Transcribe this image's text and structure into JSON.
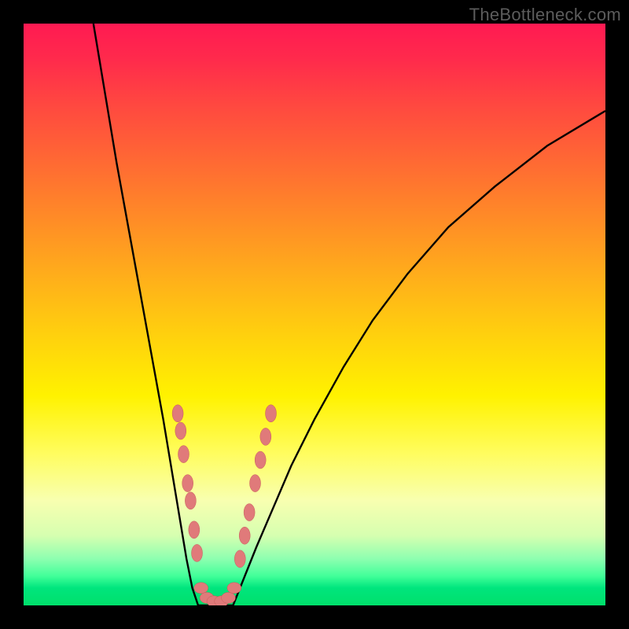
{
  "watermark": "TheBottleneck.com",
  "colors": {
    "frame": "#000000",
    "curve": "#000000",
    "marker_fill": "#e07a7a",
    "marker_stroke": "#c95a5a",
    "gradient_top": "#ff1a52",
    "gradient_mid": "#fff200",
    "gradient_bottom": "#00e06b"
  },
  "chart_data": {
    "type": "line",
    "title": "",
    "xlabel": "",
    "ylabel": "",
    "xlim": [
      0,
      100
    ],
    "ylim": [
      0,
      100
    ],
    "grid": false,
    "legend": false,
    "annotations": [],
    "series": [
      {
        "name": "left-curve",
        "x": [
          12,
          14,
          16,
          18,
          20,
          22,
          24,
          25,
          26,
          27,
          28,
          29,
          30
        ],
        "y": [
          100,
          88,
          76,
          65,
          54,
          43,
          32,
          26,
          20,
          14,
          8,
          3,
          0
        ]
      },
      {
        "name": "right-curve",
        "x": [
          36,
          38,
          40,
          43,
          46,
          50,
          55,
          60,
          66,
          73,
          81,
          90,
          100
        ],
        "y": [
          0,
          5,
          10,
          17,
          24,
          32,
          41,
          49,
          57,
          65,
          72,
          79,
          85
        ]
      },
      {
        "name": "valley-floor",
        "x": [
          30,
          31,
          32,
          33,
          34,
          35,
          36
        ],
        "y": [
          0,
          0,
          0,
          0,
          0,
          0,
          0
        ]
      }
    ],
    "markers": {
      "left_cluster": [
        {
          "x": 26.5,
          "y": 33
        },
        {
          "x": 27.0,
          "y": 30
        },
        {
          "x": 27.5,
          "y": 26
        },
        {
          "x": 28.2,
          "y": 21
        },
        {
          "x": 28.7,
          "y": 18
        },
        {
          "x": 29.3,
          "y": 13
        },
        {
          "x": 29.8,
          "y": 9
        }
      ],
      "floor_cluster": [
        {
          "x": 30.5,
          "y": 3
        },
        {
          "x": 31.5,
          "y": 1.3
        },
        {
          "x": 32.7,
          "y": 0.7
        },
        {
          "x": 34.0,
          "y": 0.7
        },
        {
          "x": 35.2,
          "y": 1.3
        },
        {
          "x": 36.2,
          "y": 3
        }
      ],
      "right_cluster": [
        {
          "x": 37.2,
          "y": 8
        },
        {
          "x": 38.0,
          "y": 12
        },
        {
          "x": 38.8,
          "y": 16
        },
        {
          "x": 39.8,
          "y": 21
        },
        {
          "x": 40.7,
          "y": 25
        },
        {
          "x": 41.6,
          "y": 29
        },
        {
          "x": 42.5,
          "y": 33
        }
      ]
    }
  }
}
